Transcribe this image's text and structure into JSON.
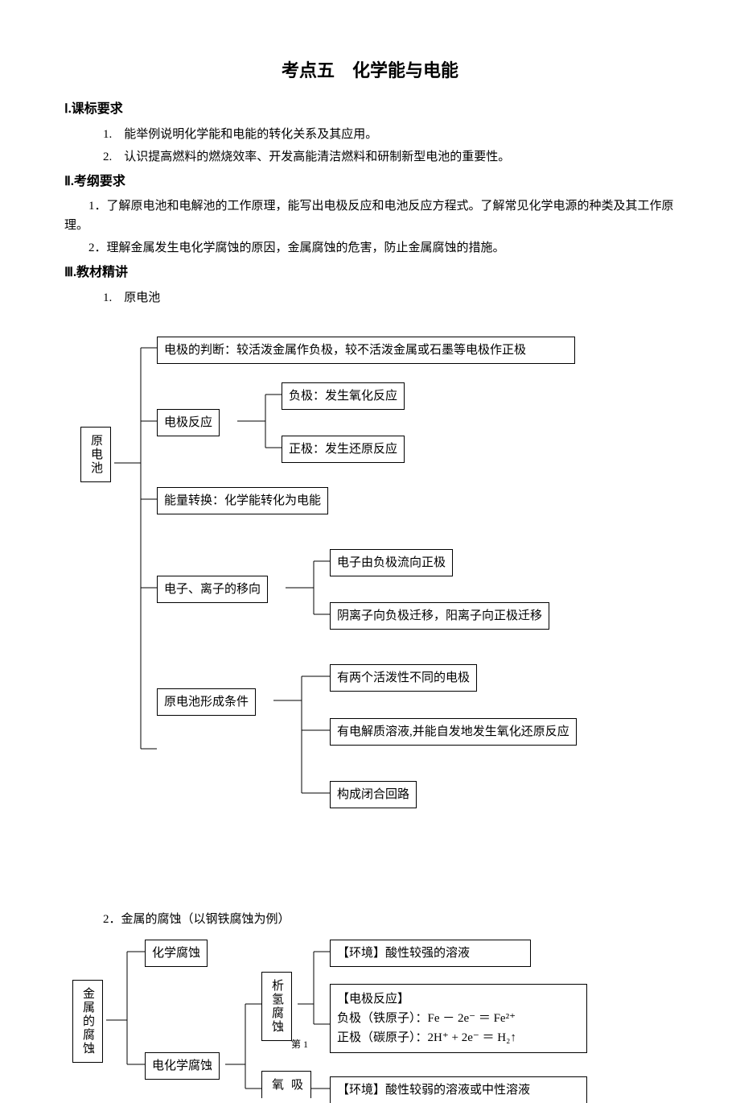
{
  "title": "考点五　化学能与电能",
  "sec1": {
    "heading": "Ⅰ.课标要求",
    "items": [
      "1.　能举例说明化学能和电能的转化关系及其应用。",
      "2.　认识提高燃料的燃烧效率、开发高能清洁燃料和研制新型电池的重要性。"
    ]
  },
  "sec2": {
    "heading": "Ⅱ.考纲要求",
    "items": [
      "1．了解原电池和电解池的工作原理，能写出电极反应和电池反应方程式。了解常见化学电源的种类及其工作原理。",
      "2．理解金属发生电化学腐蚀的原因，金属腐蚀的危害，防止金属腐蚀的措施。"
    ]
  },
  "sec3": {
    "heading": "Ⅲ.教材精讲",
    "item1": "1.　原电池",
    "item2": "2．金属的腐蚀（以钢铁腐蚀为例）"
  },
  "d1": {
    "root": "原电池",
    "n1": "电极的判断：较活泼金属作负极，较不活泼金属或石墨等电极作正极",
    "n2": "电极反应",
    "n2a": "负极：发生氧化反应",
    "n2b": "正极：发生还原反应",
    "n3": "能量转换：化学能转化为电能",
    "n4": "电子、离子的移向",
    "n4a": "电子由负极流向正极",
    "n4b": "阴离子向负极迁移，阳离子向正极迁移",
    "n5": "原电池形成条件",
    "n5a": "有两个活泼性不同的电极",
    "n5b": "有电解质溶液,并能自发地发生氧化还原反应",
    "n5c": "构成闭合回路"
  },
  "d2": {
    "root": "金属的腐蚀",
    "a": "化学腐蚀",
    "b": "电化学腐蚀",
    "c": "析氢腐蚀",
    "d": "吸氧",
    "env1": "【环境】酸性较强的溶液",
    "rxn_label": "【电极反应】",
    "rxn1": "负极（铁原子）：Fe － 2e⁻ ＝ Fe²⁺",
    "rxn2": "正极（碳原子）：2H⁺ + 2e⁻ ＝ H₂↑",
    "env2": "【环境】酸性较弱的溶液或中性溶液",
    "pg": "第 1"
  }
}
